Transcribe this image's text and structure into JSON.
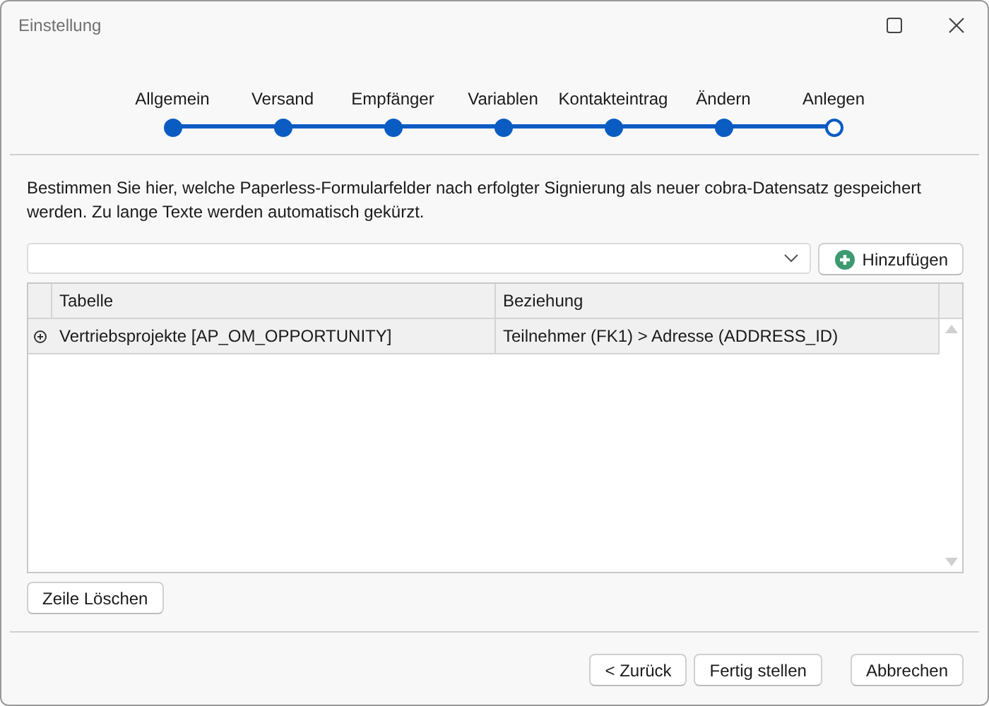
{
  "window": {
    "title": "Einstellung"
  },
  "steps": [
    {
      "label": "Allgemein",
      "completed": true
    },
    {
      "label": "Versand",
      "completed": true
    },
    {
      "label": "Empfänger",
      "completed": true
    },
    {
      "label": "Variablen",
      "completed": true
    },
    {
      "label": "Kontakteintrag",
      "completed": true
    },
    {
      "label": "Ändern",
      "completed": true
    },
    {
      "label": "Anlegen",
      "completed": false
    }
  ],
  "description": "Bestimmen Sie hier, welche Paperless-Formularfelder nach erfolgter Signierung als neuer cobra-Datensatz gespeichert werden. Zu lange Texte werden automatisch gekürzt.",
  "add_button": "Hinzufügen",
  "table": {
    "columns": [
      "Tabelle",
      "Beziehung"
    ],
    "rows": [
      {
        "expanded": false,
        "cells": [
          "Vertriebsprojekte [AP_OM_OPPORTUNITY]",
          "Teilnehmer (FK1) > Adresse (ADDRESS_ID)"
        ]
      }
    ]
  },
  "delete_button": "Zeile Löschen",
  "footer_buttons": [
    "< Zurück",
    "Fertig stellen",
    "Abbrechen"
  ]
}
